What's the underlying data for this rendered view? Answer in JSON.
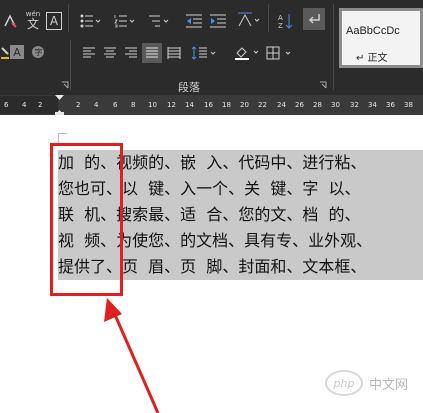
{
  "ribbon": {
    "group_label": "段落",
    "wen_label": "wén",
    "wen_char": "文",
    "a_char": "A",
    "styles": {
      "sample": "AaBbCcDc",
      "name": "↵ 正文"
    },
    "colors": {
      "background": "#2b2b2b",
      "icon": "#d0d0d0"
    }
  },
  "ruler": {
    "labels": [
      "6",
      "4",
      "2",
      "",
      "2",
      "4",
      "6",
      "8",
      "10",
      "12",
      "14",
      "16",
      "18",
      "20",
      "22",
      "24",
      "26",
      "28",
      "30",
      "32",
      "34",
      "36",
      "38"
    ]
  },
  "document": {
    "lines": [
      "加  的、视频的、嵌  入、代码中、进行粘、",
      "您也可、以  键、入一个、关  键、字  以、",
      "联  机、搜索最、适  合、您的文、档  的、",
      "视  频、为使您、的文档、具有专、业外观、",
      "提供了、页  眉、页  脚、封面和、文本框、"
    ],
    "selection_color": "#c9c9c9"
  },
  "annotation": {
    "color": "#e0201f"
  },
  "watermark": {
    "logo": "php",
    "text": "中文网"
  }
}
